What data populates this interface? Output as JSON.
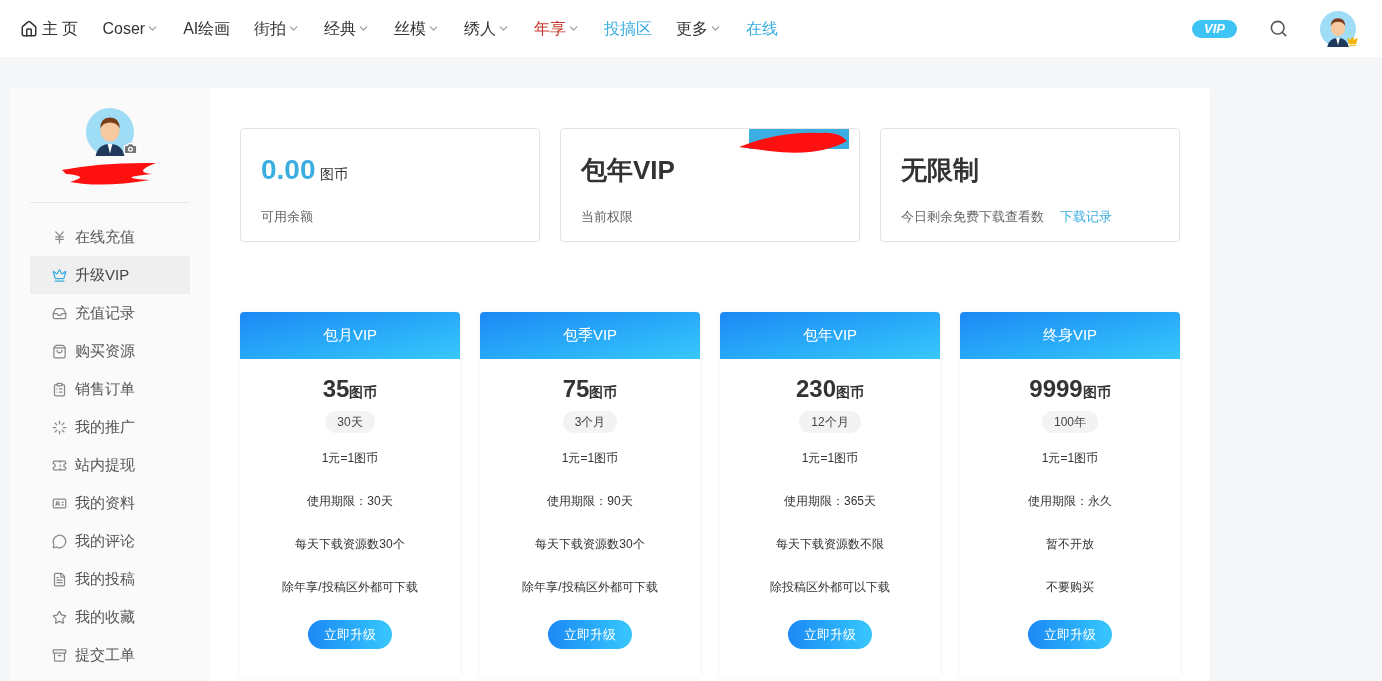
{
  "nav": {
    "items": [
      {
        "label": "主 页",
        "dropdown": false,
        "color": "#333333",
        "home": true
      },
      {
        "label": "Coser",
        "dropdown": true,
        "color": "#333333",
        "home": false
      },
      {
        "label": "AI绘画",
        "dropdown": false,
        "color": "#333333",
        "home": false
      },
      {
        "label": "街拍",
        "dropdown": true,
        "color": "#333333",
        "home": false
      },
      {
        "label": "经典",
        "dropdown": true,
        "color": "#333333",
        "home": false
      },
      {
        "label": "丝模",
        "dropdown": true,
        "color": "#333333",
        "home": false
      },
      {
        "label": "绣人",
        "dropdown": true,
        "color": "#333333",
        "home": false
      },
      {
        "label": "年享",
        "dropdown": true,
        "color": "#c8392b",
        "home": false
      },
      {
        "label": "投搞区",
        "dropdown": false,
        "color": "#3aaee0",
        "home": false
      },
      {
        "label": "更多",
        "dropdown": true,
        "color": "#333333",
        "home": false
      },
      {
        "label": "在线",
        "dropdown": false,
        "color": "#3aaee0",
        "home": false
      }
    ],
    "vip_badge": "VIP"
  },
  "sidebar": {
    "items": [
      {
        "label": "在线充值",
        "selected": false
      },
      {
        "label": "升级VIP",
        "selected": true
      },
      {
        "label": "充值记录",
        "selected": false
      },
      {
        "label": "购买资源",
        "selected": false
      },
      {
        "label": "销售订单",
        "selected": false
      },
      {
        "label": "我的推广",
        "selected": false
      },
      {
        "label": "站内提现",
        "selected": false
      },
      {
        "label": "我的资料",
        "selected": false
      },
      {
        "label": "我的评论",
        "selected": false
      },
      {
        "label": "我的投稿",
        "selected": false
      },
      {
        "label": "我的收藏",
        "selected": false
      },
      {
        "label": "提交工单",
        "selected": false
      }
    ]
  },
  "stats": [
    {
      "kind": "balance",
      "value": "0.00",
      "unit": "图币",
      "caption": "可用余额"
    },
    {
      "kind": "plan",
      "value": "包年VIP",
      "caption": "当前权限"
    },
    {
      "kind": "downloads",
      "value": "无限制",
      "caption": "今日剩余免费下载查看数",
      "link": "下载记录"
    }
  ],
  "plans": [
    {
      "title": "包月VIP",
      "price": "35",
      "unit": "图币",
      "duration": "30天",
      "features": [
        "1元=1图币",
        "使用期限：30天",
        "每天下载资源数30个",
        "除年享/投稿区外都可下载"
      ],
      "button": "立即升级"
    },
    {
      "title": "包季VIP",
      "price": "75",
      "unit": "图币",
      "duration": "3个月",
      "features": [
        "1元=1图币",
        "使用期限：90天",
        "每天下载资源数30个",
        "除年享/投稿区外都可下载"
      ],
      "button": "立即升级"
    },
    {
      "title": "包年VIP",
      "price": "230",
      "unit": "图币",
      "duration": "12个月",
      "features": [
        "1元=1图币",
        "使用期限：365天",
        "每天下载资源数不限",
        "除投稿区外都可以下载"
      ],
      "button": "立即升级"
    },
    {
      "title": "终身VIP",
      "price": "9999",
      "unit": "图币",
      "duration": "100年",
      "features": [
        "1元=1图币",
        "使用期限：永久",
        "暂不开放",
        "不要购买"
      ],
      "button": "立即升级"
    }
  ]
}
